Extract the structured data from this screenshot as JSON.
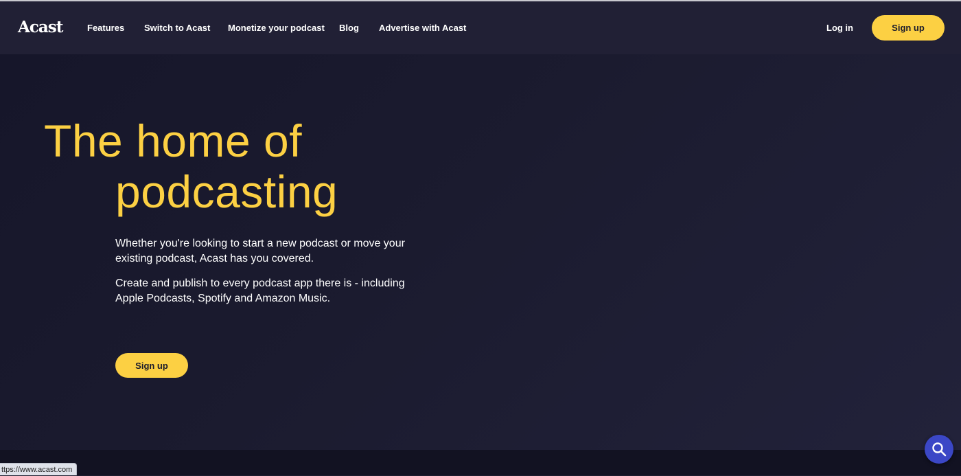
{
  "nav": {
    "logo": "Acast",
    "links": [
      "Features",
      "Switch to Acast",
      "Monetize your podcast",
      "Blog",
      "Advertise with Acast"
    ],
    "login": "Log in",
    "signup": "Sign up"
  },
  "hero": {
    "headline_line1": "The home of",
    "headline_line2": "podcasting",
    "paragraph1": "Whether you're looking to start a new podcast or move your existing podcast, Acast has you covered.",
    "paragraph2": "Create and publish to every podcast app there is - including Apple Podcasts, Spotify and Amazon Music.",
    "signup": "Sign up"
  },
  "status_bar": {
    "url": "ttps://www.acast.com"
  },
  "colors": {
    "accent": "#fcd043",
    "background": "#1e1e30",
    "help_button": "#3b47c6"
  },
  "icons": {
    "help": "search-icon"
  }
}
